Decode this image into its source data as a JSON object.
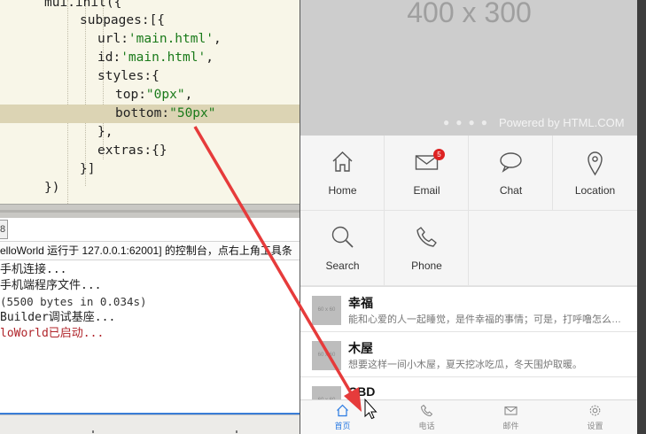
{
  "editor": {
    "lines": [
      {
        "text": "mui.init({",
        "kind": "plain"
      },
      {
        "text": "subpages:[{",
        "kind": "plain"
      },
      {
        "key": "url:",
        "value": "'main.html'",
        "tail": ","
      },
      {
        "key": "id:",
        "value": "'main.html'",
        "tail": ","
      },
      {
        "text": "styles:{",
        "kind": "plain"
      },
      {
        "key": "top:",
        "value": "\"0px\"",
        "tail": ","
      },
      {
        "key": "bottom:",
        "value": "\"50px\"",
        "tail": ""
      },
      {
        "text": "},",
        "kind": "plain"
      },
      {
        "text": "extras:{}",
        "kind": "plain"
      },
      {
        "text": "}]",
        "kind": "plain"
      },
      {
        "text": "})",
        "kind": "plain"
      }
    ]
  },
  "console": {
    "tab_label": "8",
    "title": "elloWorld 运行于 127.0.0.1:62001] 的控制台，点右上角工具条",
    "lines": [
      {
        "text": "手机连接...",
        "color": "normal"
      },
      {
        "text": "手机端程序文件...",
        "color": "normal"
      },
      {
        "text": "(5500 bytes in 0.034s)",
        "color": "gray"
      },
      {
        "text": "Builder调试基座...",
        "color": "normal"
      },
      {
        "text": "loWorld已启动...",
        "color": "red"
      }
    ]
  },
  "phone": {
    "slider": {
      "placeholder_text": "400 x 300",
      "powered_by": "Powered by HTML.COM"
    },
    "grid": [
      {
        "label": "Home",
        "icon": "home-icon"
      },
      {
        "label": "Email",
        "icon": "email-icon",
        "badge": "5"
      },
      {
        "label": "Chat",
        "icon": "chat-icon"
      },
      {
        "label": "Location",
        "icon": "location-icon"
      },
      {
        "label": "Search",
        "icon": "search-icon"
      },
      {
        "label": "Phone",
        "icon": "phone-icon"
      }
    ],
    "list": [
      {
        "title": "幸福",
        "desc": "能和心爱的人一起睡觉，是件幸福的事情；可是，打呼噜怎么办？",
        "thumb": "60 x 60"
      },
      {
        "title": "木屋",
        "desc": "想要这样一间小木屋，夏天挖冰吃瓜，冬天围炉取暖。",
        "thumb": "60 x 60"
      },
      {
        "title": "CBD",
        "desc": "",
        "thumb": "60 x 60"
      }
    ],
    "tabbar": [
      {
        "label": "首页",
        "icon": "home-icon",
        "active": true
      },
      {
        "label": "电话",
        "icon": "phone-icon",
        "active": false
      },
      {
        "label": "邮件",
        "icon": "email-icon",
        "active": false
      },
      {
        "label": "设置",
        "icon": "gear-icon",
        "active": false
      }
    ]
  },
  "colors": {
    "accent": "#2a7ae2",
    "badge": "#dd2222",
    "arrow": "#e63b3b",
    "string": "#1a7a1a"
  }
}
